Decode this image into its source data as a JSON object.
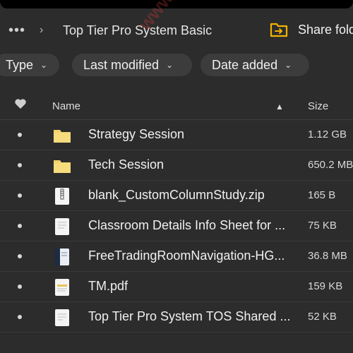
{
  "breadcrumb": {
    "more_icon": "more-dots-icon",
    "separator": "›",
    "title": "Top Tier Pro System Basic"
  },
  "share": {
    "label": "Share folder",
    "icon": "share-folder-icon",
    "icon_color": "#f0b400"
  },
  "filters": {
    "type_label": "Type",
    "modified_label": "Last modified",
    "added_label": "Date added"
  },
  "table": {
    "header": {
      "favorite_icon": "heart-icon",
      "name": "Name",
      "sort_icon": "chevron-up-icon",
      "size": "Size"
    },
    "rows": [
      {
        "name": "Strategy Session",
        "size": "1.12 GB",
        "icon": "folder-icon"
      },
      {
        "name": "Tech Session",
        "size": "650.2 MB",
        "icon": "folder-icon"
      },
      {
        "name": "blank_CustomColumnStudy.zip",
        "size": "165 B",
        "icon": "zip-file-icon"
      },
      {
        "name": "Classroom Details Info Sheet for ...",
        "size": "75 KB",
        "icon": "document-icon"
      },
      {
        "name": "FreeTradingRoomNavigation-HG...",
        "size": "36.8 MB",
        "icon": "video-file-icon"
      },
      {
        "name": "TM.pdf",
        "size": "159 KB",
        "icon": "pdf-file-icon"
      },
      {
        "name": "Top Tier Pro System TOS Shared ...",
        "size": "52 KB",
        "icon": "document-icon"
      }
    ]
  },
  "watermark": "www.tradesmint.com",
  "colors": {
    "background": "#2c2c2c",
    "chip": "#3c3c3c",
    "folder": "#f5d36b"
  }
}
